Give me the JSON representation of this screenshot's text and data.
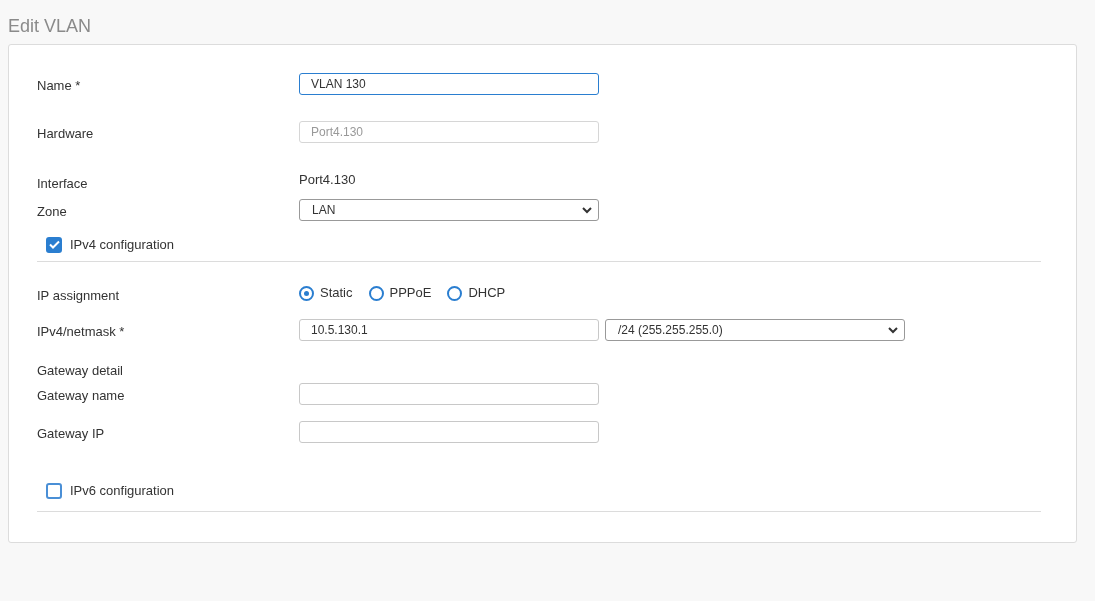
{
  "title": "Edit VLAN",
  "name": {
    "label": "Name *",
    "value": "VLAN 130"
  },
  "hardware": {
    "label": "Hardware",
    "value": "Port4.130",
    "disabled": true
  },
  "interface": {
    "label": "Interface",
    "value": "Port4.130"
  },
  "zone": {
    "label": "Zone",
    "value": "LAN"
  },
  "ipv4": {
    "label": "IPv4 configuration",
    "checked": true
  },
  "ip_assignment": {
    "label": "IP assignment",
    "options": [
      {
        "label": "Static",
        "selected": true
      },
      {
        "label": "PPPoE",
        "selected": false
      },
      {
        "label": "DHCP",
        "selected": false
      }
    ]
  },
  "netmask": {
    "label": "IPv4/netmask *",
    "ip_value": "10.5.130.1",
    "mask_value": "/24 (255.255.255.0)"
  },
  "gateway_detail": {
    "label": "Gateway detail"
  },
  "gateway_name": {
    "label": "Gateway name"
  },
  "gateway_ip": {
    "label": "Gateway IP"
  },
  "ipv6": {
    "label": "IPv6 configuration",
    "checked": false
  }
}
